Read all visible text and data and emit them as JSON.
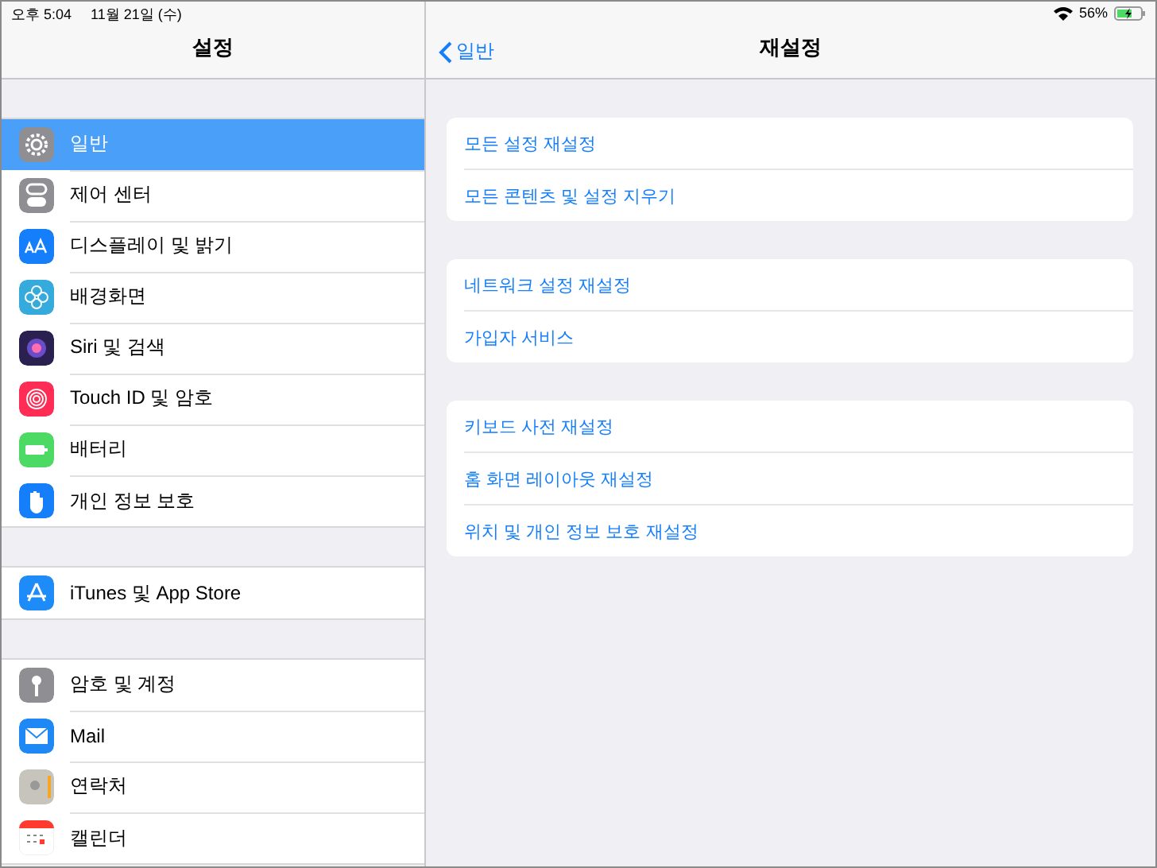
{
  "status_bar": {
    "time": "오후 5:04",
    "date": "11월 21일 (수)",
    "battery": "56%"
  },
  "sidebar": {
    "title": "설정",
    "groups": [
      [
        {
          "label": "일반",
          "selected": true
        },
        {
          "label": "제어 센터",
          "selected": false
        },
        {
          "label": "디스플레이 및 밝기",
          "selected": false
        },
        {
          "label": "배경화면",
          "selected": false
        },
        {
          "label": "Siri 및 검색",
          "selected": false
        },
        {
          "label": "Touch ID 및 암호",
          "selected": false
        },
        {
          "label": "배터리",
          "selected": false
        },
        {
          "label": "개인 정보 보호",
          "selected": false
        }
      ],
      [
        {
          "label": "iTunes 및 App Store",
          "selected": false
        }
      ],
      [
        {
          "label": "암호 및 계정",
          "selected": false
        },
        {
          "label": "Mail",
          "selected": false
        },
        {
          "label": "연락처",
          "selected": false
        },
        {
          "label": "캘린더",
          "selected": false
        }
      ]
    ]
  },
  "detail": {
    "back": "일반",
    "title": "재설정",
    "groups": [
      [
        "모든 설정 재설정",
        "모든 콘텐츠 및 설정 지우기"
      ],
      [
        "네트워크 설정 재설정",
        "가입자 서비스"
      ],
      [
        "키보드 사전 재설정",
        "홈 화면 레이아웃 재설정",
        "위치 및 개인 정보 보호 재설정"
      ]
    ]
  }
}
